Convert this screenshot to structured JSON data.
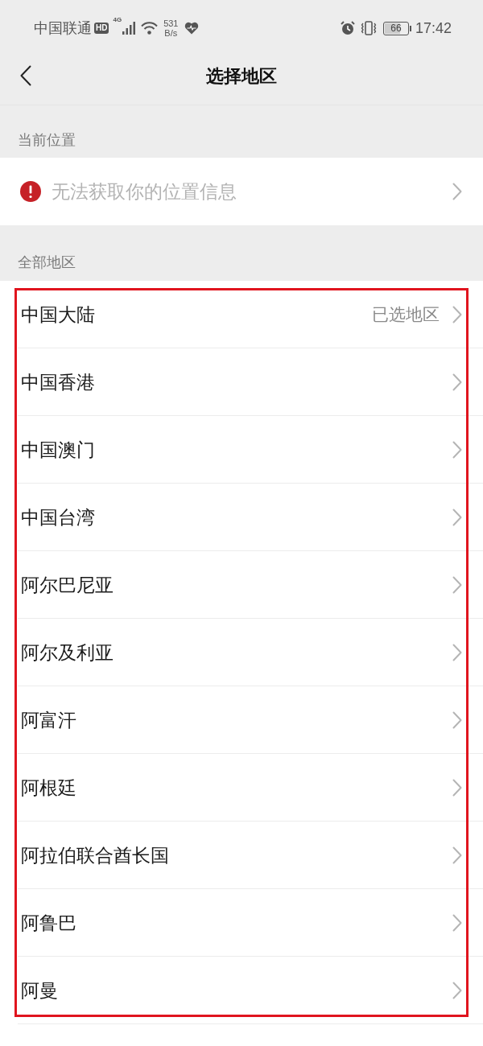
{
  "status_bar": {
    "carrier": "中国联通",
    "hd_badge": "HD",
    "network_type": "4G",
    "speed_value": "531",
    "speed_unit": "B/s",
    "battery": "66",
    "time": "17:42"
  },
  "nav": {
    "title": "选择地区"
  },
  "current_location": {
    "header": "当前位置",
    "message": "无法获取你的位置信息"
  },
  "all_regions": {
    "header": "全部地区",
    "items": [
      {
        "name": "中国大陆",
        "note": "已选地区"
      },
      {
        "name": "中国香港"
      },
      {
        "name": "中国澳门"
      },
      {
        "name": "中国台湾"
      },
      {
        "name": "阿尔巴尼亚"
      },
      {
        "name": "阿尔及利亚"
      },
      {
        "name": "阿富汗"
      },
      {
        "name": "阿根廷"
      },
      {
        "name": "阿拉伯联合酋长国"
      },
      {
        "name": "阿鲁巴"
      },
      {
        "name": "阿曼"
      }
    ]
  }
}
